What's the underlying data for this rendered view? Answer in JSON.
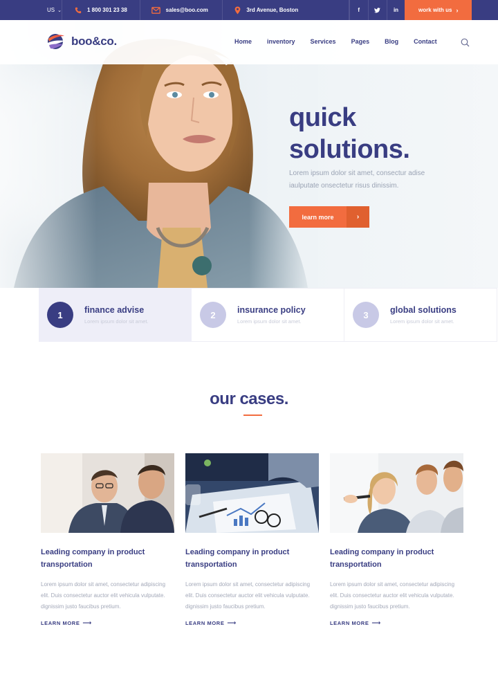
{
  "topbar": {
    "lang": "US",
    "phone": "1 800 301 23 38",
    "email": "sales@boo.com",
    "address": "3rd Avenue, Boston",
    "social": [
      "f",
      "t",
      "in"
    ],
    "work_label": "work with us"
  },
  "header": {
    "logo_text": "boo&co.",
    "nav": [
      "Home",
      "inventory",
      "Services",
      "Pages",
      "Blog",
      "Contact"
    ]
  },
  "hero": {
    "title_line1": "quick",
    "title_line2": "solutions.",
    "subtitle": "Lorem ipsum dolor sit amet, consectur adise iaulputate onsectetur risus dinissim.",
    "button_label": "learn more"
  },
  "features": [
    {
      "num": "1",
      "title": "finance advise",
      "desc": "Lorem ipsum dolor sit amet."
    },
    {
      "num": "2",
      "title": "insurance policy",
      "desc": "Lorem ipsum dolor sit amet."
    },
    {
      "num": "3",
      "title": "global solutions",
      "desc": "Lorem ipsum dolor sit amet."
    }
  ],
  "cases": {
    "title": "our cases.",
    "items": [
      {
        "title": "Leading company in product transportation",
        "text": "Lorem ipsum dolor sit amet, consectetur adipiscing elit. Duis consectetur auctor elit vehicula vulputate. dignissim justo faucibus pretium.",
        "link": "LEARN MORE"
      },
      {
        "title": "Leading company in product transportation",
        "text": "Lorem ipsum dolor sit amet, consectetur adipiscing elit. Duis consectetur auctor elit vehicula vulputate. dignissim justo faucibus pretium.",
        "link": "LEARN MORE"
      },
      {
        "title": "Leading company in product transportation",
        "text": "Lorem ipsum dolor sit amet, consectetur adipiscing elit. Duis consectetur auctor elit vehicula vulputate. dignissim justo faucibus pretium.",
        "link": "LEARN MORE"
      }
    ]
  },
  "colors": {
    "primary": "#393d82",
    "accent": "#f26c3f",
    "muted_text": "#a3a8b8"
  }
}
